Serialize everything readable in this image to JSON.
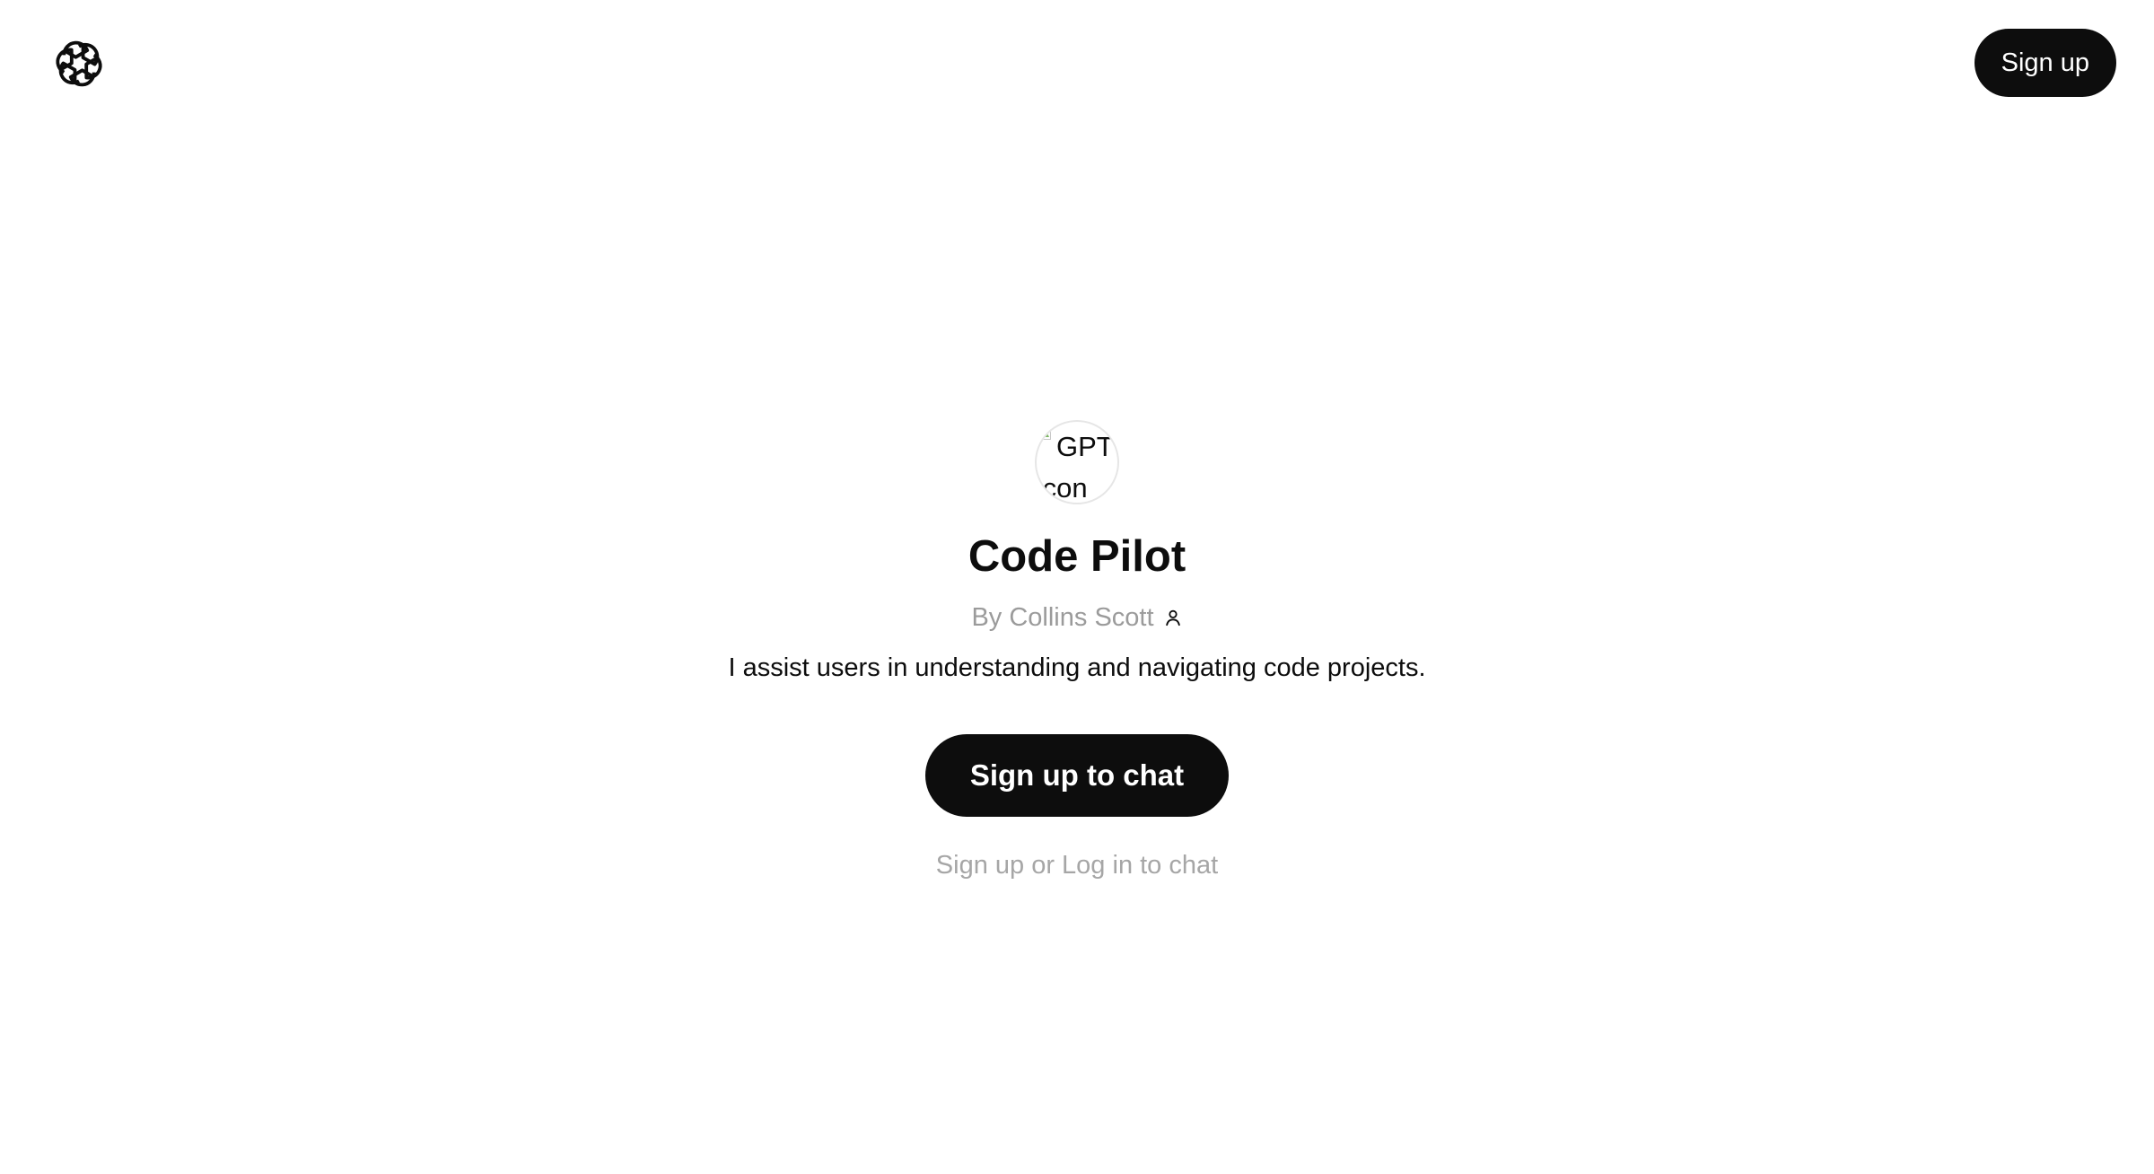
{
  "header": {
    "logo_icon": "openai-logo-icon",
    "signup_label": "Sign up"
  },
  "gpt": {
    "avatar_alt": "GPT Icon",
    "avatar_alt_line1": "GPT",
    "avatar_alt_line2": "Icon",
    "name": "Code Pilot",
    "author": "By Collins Scott",
    "author_icon": "person-icon",
    "description": "I assist users in understanding and navigating code projects."
  },
  "cta": {
    "label": "Sign up to chat",
    "note": "Sign up or Log in to chat"
  },
  "colors": {
    "primary": "#0d0d0d",
    "muted_text": "#9b9b9b",
    "background": "#ffffff"
  }
}
